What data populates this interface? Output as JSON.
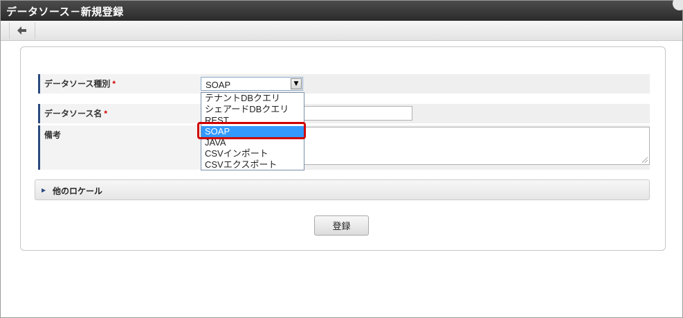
{
  "window": {
    "title": "データソース－新規登録"
  },
  "toolbar": {
    "back_icon": "arrow-left-icon"
  },
  "form": {
    "type_label": "データソース種別",
    "type_required": "*",
    "type_selected": "SOAP",
    "name_label": "データソース名",
    "name_required": "*",
    "name_value": "",
    "note_label": "備考",
    "note_value": ""
  },
  "dropdown": {
    "options": [
      {
        "label": "テナントDBクエリ"
      },
      {
        "label": "シェアードDBクエリ"
      },
      {
        "label": "REST"
      },
      {
        "label": "SOAP"
      },
      {
        "label": "JAVA"
      },
      {
        "label": "CSVインポート"
      },
      {
        "label": "CSVエクスポート"
      }
    ],
    "selected_index": 3
  },
  "locale": {
    "label": "他のロケール"
  },
  "actions": {
    "register_label": "登録"
  },
  "colors": {
    "highlight": "#d00000",
    "selection": "#3399ff",
    "accent": "#2a4a7f"
  }
}
